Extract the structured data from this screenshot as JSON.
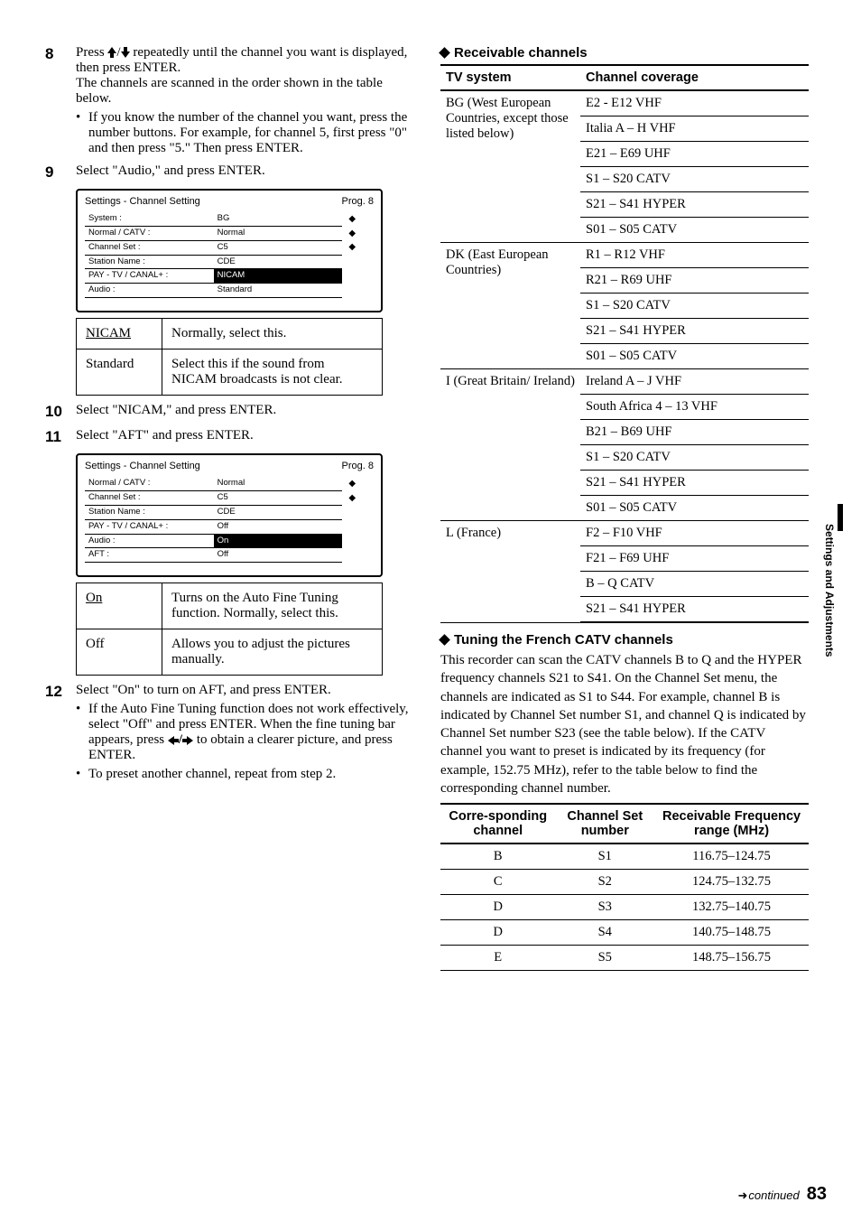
{
  "left": {
    "step8": {
      "num": "8",
      "text1": "Press ",
      "text2": " repeatedly until the channel you want is displayed, then press ENTER.",
      "text3": "The channels are scanned in the order shown in the table below.",
      "bullet": "If you know the number of the channel you want, press the number buttons. For example, for channel 5, first press \"0\" and then press \"5.\" Then press ENTER."
    },
    "step9": {
      "num": "9",
      "text": "Select \"Audio,\" and press ENTER."
    },
    "osd1": {
      "title": "Settings - Channel Setting",
      "prog": "Prog. 8",
      "rows": [
        {
          "k": "System :",
          "v": "BG",
          "a": "◆"
        },
        {
          "k": "Normal / CATV :",
          "v": "Normal",
          "a": "◆"
        },
        {
          "k": "Channel Set :",
          "v": "C5",
          "a": "◆"
        },
        {
          "k": "Station Name :",
          "v": "CDE",
          "a": ""
        },
        {
          "k": "PAY - TV / CANAL+ :",
          "v": "NICAM",
          "a": "",
          "hl": true
        },
        {
          "k": "Audio :",
          "v": "Standard",
          "a": ""
        }
      ]
    },
    "optAudio": [
      {
        "k": "NICAM",
        "kClass": "ul",
        "v": "Normally, select this."
      },
      {
        "k": "Standard",
        "v": "Select this if the sound from NICAM broadcasts is not clear."
      }
    ],
    "step10": {
      "num": "10",
      "text": "Select \"NICAM,\" and press ENTER."
    },
    "step11": {
      "num": "11",
      "text": "Select \"AFT\" and press ENTER."
    },
    "osd2": {
      "title": "Settings - Channel Setting",
      "prog": "Prog. 8",
      "rows": [
        {
          "k": "Normal / CATV :",
          "v": "Normal",
          "a": "◆"
        },
        {
          "k": "Channel Set :",
          "v": "C5",
          "a": "◆"
        },
        {
          "k": "Station Name :",
          "v": "CDE",
          "a": ""
        },
        {
          "k": "PAY - TV / CANAL+ :",
          "v": "Off",
          "a": ""
        },
        {
          "k": "Audio :",
          "v": "On",
          "a": "",
          "hl": true
        },
        {
          "k": "AFT :",
          "v": "Off",
          "a": ""
        }
      ]
    },
    "optAft": [
      {
        "k": "On",
        "kClass": "ul",
        "v": "Turns on the Auto Fine Tuning function. Normally, select this."
      },
      {
        "k": "Off",
        "v": "Allows you to adjust the pictures manually."
      }
    ],
    "step12": {
      "num": "12",
      "text": "Select \"On\" to turn on AFT, and press ENTER.",
      "b1a": "If the Auto Fine Tuning function does not work effectively, select \"Off\" and press ENTER. When the fine tuning bar appears, press ",
      "b1b": " to obtain a clearer picture, and press ENTER.",
      "b2": "To preset another channel, repeat from step 2."
    }
  },
  "right": {
    "recvTitle": "Receivable channels",
    "chHead": {
      "a": "TV system",
      "b": "Channel coverage"
    },
    "chRows": [
      {
        "sys": "BG (West European Countries, except those listed below)",
        "span": 6,
        "cov": "E2 - E12 VHF"
      },
      {
        "cov": "Italia A – H VHF"
      },
      {
        "cov": "E21 – E69 UHF"
      },
      {
        "cov": "S1 – S20 CATV"
      },
      {
        "cov": "S21 – S41 HYPER"
      },
      {
        "cov": "S01 – S05 CATV"
      },
      {
        "sys": "DK (East European Countries)",
        "span": 5,
        "cov": "R1 – R12 VHF"
      },
      {
        "cov": "R21 – R69 UHF"
      },
      {
        "cov": "S1 – S20 CATV"
      },
      {
        "cov": "S21 – S41 HYPER"
      },
      {
        "cov": "S01 – S05 CATV"
      },
      {
        "sys": "I (Great Britain/ Ireland)",
        "span": 6,
        "cov": "Ireland A – J VHF"
      },
      {
        "cov": "South Africa 4 – 13 VHF"
      },
      {
        "cov": "B21 – B69 UHF"
      },
      {
        "cov": "S1 – S20 CATV"
      },
      {
        "cov": "S21 – S41 HYPER"
      },
      {
        "cov": "S01 – S05 CATV"
      },
      {
        "sys": "L (France)",
        "span": 4,
        "cov": "F2 – F10 VHF"
      },
      {
        "cov": "F21 – F69 UHF"
      },
      {
        "cov": "B – Q CATV"
      },
      {
        "cov": "S21 – S41 HYPER",
        "last": true
      }
    ],
    "frTitle": "Tuning the French CATV channels",
    "frPara": "This recorder can scan the CATV channels B to Q and the HYPER frequency channels S21 to S41. On the Channel Set menu, the channels are indicated as S1 to S44. For example, channel B is indicated by Channel Set number S1, and channel Q is indicated by Channel Set number S23 (see the table below). If the CATV channel you want to preset is indicated by its frequency (for example, 152.75 MHz), refer to the table below to find the corresponding channel number.",
    "fHead": {
      "a": "Corre-sponding channel",
      "b": "Channel Set number",
      "c": "Receivable Frequency range (MHz)"
    },
    "fRows": [
      {
        "a": "B",
        "b": "S1",
        "c": "116.75–124.75"
      },
      {
        "a": "C",
        "b": "S2",
        "c": "124.75–132.75"
      },
      {
        "a": "D",
        "b": "S3",
        "c": "132.75–140.75"
      },
      {
        "a": "D",
        "b": "S4",
        "c": "140.75–148.75"
      },
      {
        "a": "E",
        "b": "S5",
        "c": "148.75–156.75"
      }
    ]
  },
  "sideTab": "Settings and Adjustments",
  "footer": {
    "cont": "continued",
    "pg": "83"
  }
}
